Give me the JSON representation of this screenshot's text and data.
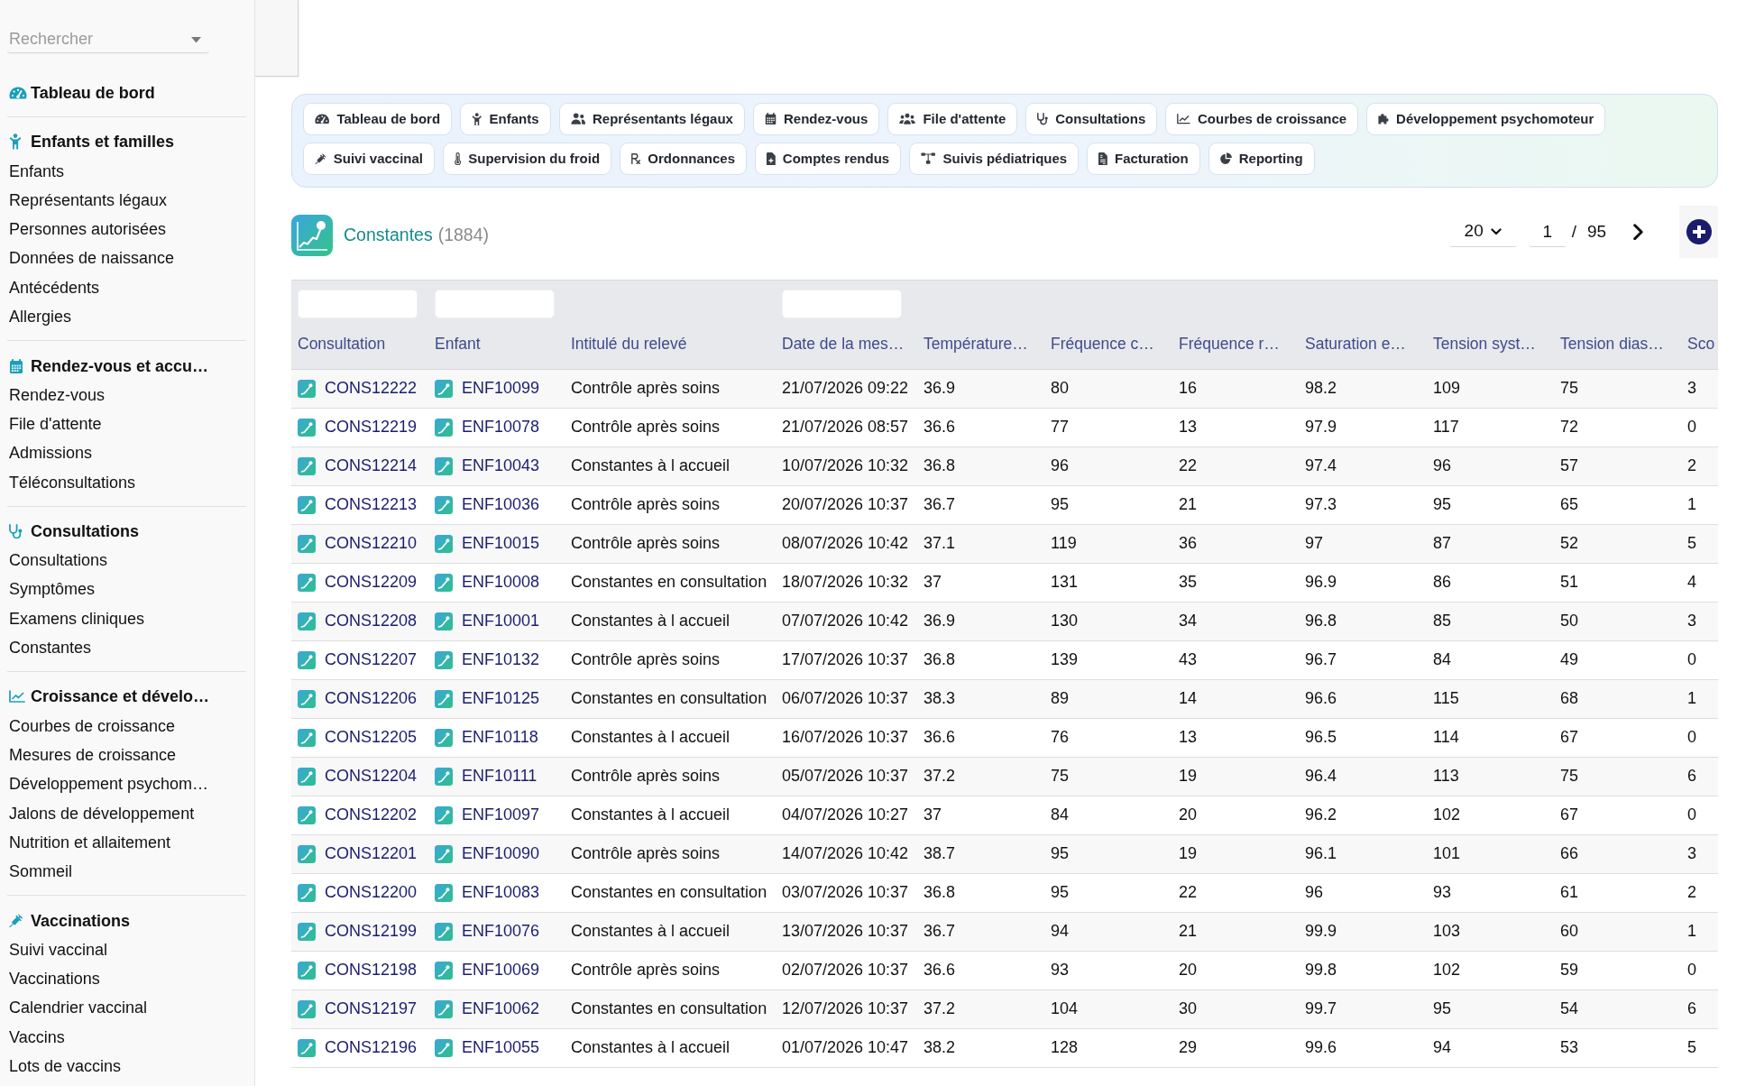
{
  "sidebar": {
    "search": {
      "placeholder": "Rechercher"
    },
    "sections": [
      {
        "title": "Tableau de bord"
      },
      {
        "title": "Enfants et familles",
        "items": [
          "Enfants",
          "Représentants légaux",
          "Personnes autorisées",
          "Données de naissance",
          "Antécédents",
          "Allergies"
        ]
      },
      {
        "title": "Rendez-vous et accu…",
        "items": [
          "Rendez-vous",
          "File d'attente",
          "Admissions",
          "Téléconsultations"
        ]
      },
      {
        "title": "Consultations",
        "items": [
          "Consultations",
          "Symptômes",
          "Examens cliniques",
          "Constantes"
        ]
      },
      {
        "title": "Croissance et dévelo…",
        "items": [
          "Courbes de croissance",
          "Mesures de croissance",
          "Développement psychom…",
          "Jalons de développement",
          "Nutrition et allaitement",
          "Sommeil"
        ]
      },
      {
        "title": "Vaccinations",
        "items": [
          "Suivi vaccinal",
          "Vaccinations",
          "Calendrier vaccinal",
          "Vaccins",
          "Lots de vaccins"
        ]
      }
    ]
  },
  "quick_links": [
    "Tableau de bord",
    "Enfants",
    "Représentants légaux",
    "Rendez-vous",
    "File d'attente",
    "Consultations",
    "Courbes de croissance",
    "Développement psychomoteur",
    "Suivi vaccinal",
    "Supervision du froid",
    "Ordonnances",
    "Comptes rendus",
    "Suivis pédiatriques",
    "Facturation",
    "Reporting"
  ],
  "page_header": {
    "title": "Constantes",
    "count": "(1884)"
  },
  "pagination": {
    "page_size": "20",
    "page": "1",
    "separator": "/",
    "total_pages": "95"
  },
  "table": {
    "columns": [
      {
        "label": "Consultation",
        "kind": "link",
        "filter": true
      },
      {
        "label": "Enfant",
        "kind": "link",
        "filter": true
      },
      {
        "label": "Intitulé du relevé",
        "kind": "text",
        "filter": false
      },
      {
        "label": "Date de la mes…",
        "kind": "text",
        "filter": true
      },
      {
        "label": "Température…",
        "kind": "text",
        "filter": false
      },
      {
        "label": "Fréquence c…",
        "kind": "text",
        "filter": false
      },
      {
        "label": "Fréquence r…",
        "kind": "text",
        "filter": false
      },
      {
        "label": "Saturation e…",
        "kind": "text",
        "filter": false
      },
      {
        "label": "Tension syst…",
        "kind": "text",
        "filter": false
      },
      {
        "label": "Tension dias…",
        "kind": "text",
        "filter": false
      },
      {
        "label": "Sco",
        "kind": "text",
        "filter": false
      }
    ],
    "rows": [
      [
        "CONS12222",
        "ENF10099",
        "Contrôle après soins",
        "21/07/2026 09:22",
        "36.9",
        "80",
        "16",
        "98.2",
        "109",
        "75",
        "3"
      ],
      [
        "CONS12219",
        "ENF10078",
        "Contrôle après soins",
        "21/07/2026 08:57",
        "36.6",
        "77",
        "13",
        "97.9",
        "117",
        "72",
        "0"
      ],
      [
        "CONS12214",
        "ENF10043",
        "Constantes à l accueil",
        "10/07/2026 10:32",
        "36.8",
        "96",
        "22",
        "97.4",
        "96",
        "57",
        "2"
      ],
      [
        "CONS12213",
        "ENF10036",
        "Contrôle après soins",
        "20/07/2026 10:37",
        "36.7",
        "95",
        "21",
        "97.3",
        "95",
        "65",
        "1"
      ],
      [
        "CONS12210",
        "ENF10015",
        "Contrôle après soins",
        "08/07/2026 10:42",
        "37.1",
        "119",
        "36",
        "97",
        "87",
        "52",
        "5"
      ],
      [
        "CONS12209",
        "ENF10008",
        "Constantes en consultation",
        "18/07/2026 10:32",
        "37",
        "131",
        "35",
        "96.9",
        "86",
        "51",
        "4"
      ],
      [
        "CONS12208",
        "ENF10001",
        "Constantes à l accueil",
        "07/07/2026 10:42",
        "36.9",
        "130",
        "34",
        "96.8",
        "85",
        "50",
        "3"
      ],
      [
        "CONS12207",
        "ENF10132",
        "Contrôle après soins",
        "17/07/2026 10:37",
        "36.8",
        "139",
        "43",
        "96.7",
        "84",
        "49",
        "0"
      ],
      [
        "CONS12206",
        "ENF10125",
        "Constantes en consultation",
        "06/07/2026 10:37",
        "38.3",
        "89",
        "14",
        "96.6",
        "115",
        "68",
        "1"
      ],
      [
        "CONS12205",
        "ENF10118",
        "Constantes à l accueil",
        "16/07/2026 10:37",
        "36.6",
        "76",
        "13",
        "96.5",
        "114",
        "67",
        "0"
      ],
      [
        "CONS12204",
        "ENF10111",
        "Contrôle après soins",
        "05/07/2026 10:37",
        "37.2",
        "75",
        "19",
        "96.4",
        "113",
        "75",
        "6"
      ],
      [
        "CONS12202",
        "ENF10097",
        "Constantes à l accueil",
        "04/07/2026 10:27",
        "37",
        "84",
        "20",
        "96.2",
        "102",
        "67",
        "0"
      ],
      [
        "CONS12201",
        "ENF10090",
        "Contrôle après soins",
        "14/07/2026 10:42",
        "38.7",
        "95",
        "19",
        "96.1",
        "101",
        "66",
        "3"
      ],
      [
        "CONS12200",
        "ENF10083",
        "Constantes en consultation",
        "03/07/2026 10:37",
        "36.8",
        "95",
        "22",
        "96",
        "93",
        "61",
        "2"
      ],
      [
        "CONS12199",
        "ENF10076",
        "Constantes à l accueil",
        "13/07/2026 10:37",
        "36.7",
        "94",
        "21",
        "99.9",
        "103",
        "60",
        "1"
      ],
      [
        "CONS12198",
        "ENF10069",
        "Contrôle après soins",
        "02/07/2026 10:37",
        "36.6",
        "93",
        "20",
        "99.8",
        "102",
        "59",
        "0"
      ],
      [
        "CONS12197",
        "ENF10062",
        "Constantes en consultation",
        "12/07/2026 10:37",
        "37.2",
        "104",
        "30",
        "99.7",
        "95",
        "54",
        "6"
      ],
      [
        "CONS12196",
        "ENF10055",
        "Constantes à l accueil",
        "01/07/2026 10:47",
        "38.2",
        "128",
        "29",
        "99.6",
        "94",
        "53",
        "5"
      ]
    ]
  }
}
